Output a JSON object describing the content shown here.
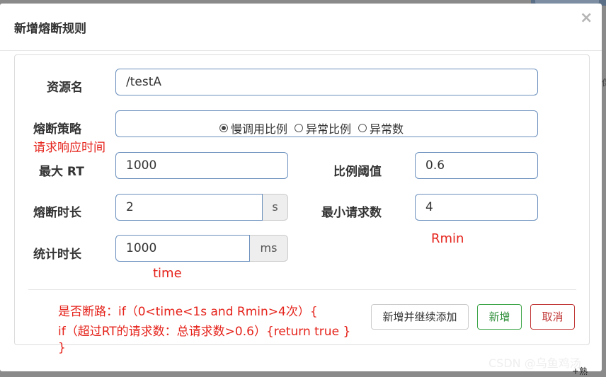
{
  "modal": {
    "title": "新增熔断规则",
    "close_icon": "×"
  },
  "form": {
    "resource": {
      "label": "资源名",
      "value": "/testA"
    },
    "strategy": {
      "label": "熔断策略",
      "options": [
        "慢调用比例",
        "异常比例",
        "异常数"
      ],
      "selected": "慢调用比例"
    },
    "max_rt": {
      "label": "最大 RT",
      "value": "1000"
    },
    "ratio_threshold": {
      "label": "比例阈值",
      "value": "0.6"
    },
    "duration": {
      "label": "熔断时长",
      "value": "2",
      "unit": "s"
    },
    "min_requests": {
      "label": "最小请求数",
      "value": "4"
    },
    "stat_duration": {
      "label": "统计时长",
      "value": "1000",
      "unit": "ms"
    }
  },
  "annotations": {
    "response_time": "请求响应时间",
    "rmin": "Rmin",
    "time": "time",
    "logic_line1": "是否断路：if（0<time<1s and Rmin>4次）{",
    "logic_line2": "if（超过RT的请求数：总请求数>0.6）{return true }",
    "logic_line3": "}"
  },
  "buttons": {
    "add_continue": "新增并继续添加",
    "add": "新增",
    "cancel": "取消"
  },
  "watermark": "CSDN @乌鱼鸡汤",
  "background": {
    "right_edge_text": "保",
    "bottom_right_text": "+熟"
  }
}
